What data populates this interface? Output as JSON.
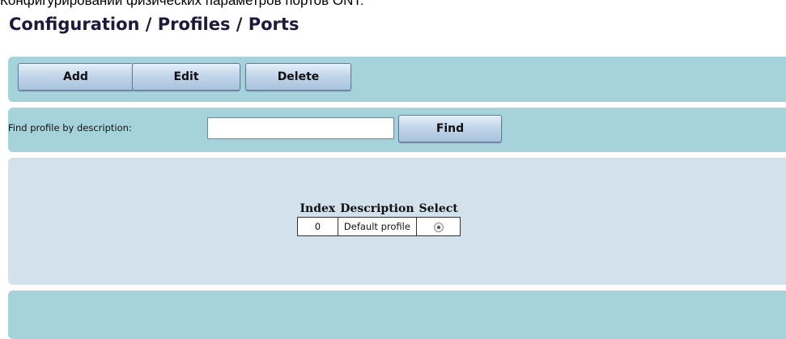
{
  "caption": "Конфигурировании физических параметров портов ONT:",
  "page": {
    "title": "Configuration / Profiles / Ports"
  },
  "toolbar": {
    "add_label": "Add",
    "edit_label": "Edit",
    "delete_label": "Delete"
  },
  "search": {
    "label": "Find profile by description:",
    "value": "",
    "find_label": "Find"
  },
  "table": {
    "headers": [
      "Index",
      "Description",
      "Select"
    ],
    "rows": [
      {
        "index": "0",
        "description": "Default profile",
        "selected": true
      }
    ]
  }
}
